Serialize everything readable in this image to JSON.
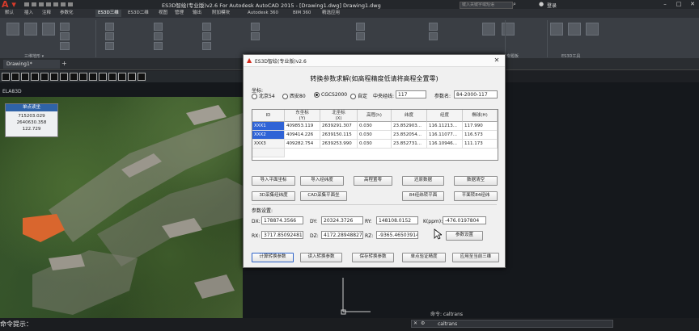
{
  "app": {
    "window_title": "ES3D智绘(专业版)v2.6 For Autodesk AutoCAD 2015 - [Drawing1.dwg]     Drawing1.dwg",
    "search_placeholder": "键入关键字或短语",
    "login": "登录"
  },
  "ribbon_tabs": [
    "默认",
    "插入",
    "注释",
    "参数化",
    "ES3D三维",
    "ES3D二维",
    "视图",
    "管理",
    "输出",
    "附加模块",
    "Autodesk 360",
    "BIM 360",
    "精选应用"
  ],
  "ribbon_active_tab": "ES3D三维",
  "ribbon_groups": [
    "三维地形 ▾",
    "专题板",
    "ES3D工具"
  ],
  "doc_tab": "Drawing1*",
  "viewport_label": "ELA83D",
  "coord_panel": {
    "title": "单点读坐",
    "values": [
      "715203.029",
      "2640630.358",
      "122.729"
    ]
  },
  "command": {
    "prompt": "命令提示：",
    "history": "命令: caltrans",
    "input": "caltrans"
  },
  "dialog": {
    "title": "ES3D智绘(专业版)v2.6",
    "heading": "转换参数求解(如高程精度低请将高程全置零)",
    "coord_label": "坐标:",
    "systems": [
      {
        "label": "北京54",
        "selected": false
      },
      {
        "label": "西安80",
        "selected": false
      },
      {
        "label": "CGCS2000",
        "selected": true
      },
      {
        "label": "自定",
        "selected": false
      }
    ],
    "central_meridian_label": "中央经线:",
    "central_meridian": "117",
    "param_name_label": "参数名:",
    "param_name": "84-2000-117",
    "table": {
      "columns": [
        "ID",
        "东坐标\n(Y)",
        "北坐标\n(X)",
        "高程(h)",
        "纬度",
        "经度",
        "椭球(H)"
      ],
      "rows": [
        [
          "XXX1",
          "409853.119",
          "2639291.307",
          "0.030",
          "23.852903...",
          "116.11213...",
          "117.990"
        ],
        [
          "XXX2",
          "409414.226",
          "2639150.115",
          "0.030",
          "23.852054...",
          "116.11077...",
          "116.573"
        ],
        [
          "XXX3",
          "409282.754",
          "2639253.990",
          "0.030",
          "23.852731...",
          "116.10946...",
          "111.173"
        ]
      ]
    },
    "buttons_row1": [
      "导入平面坐标",
      "导入经纬度",
      "高程置零",
      "还原数据",
      "数据清空"
    ],
    "buttons_row2": [
      "3D采集经纬度",
      "CAD采集平面坐",
      "84经纬转平面",
      "平面转84经纬"
    ],
    "params_label": "参数设置:",
    "params": [
      {
        "label": "DX:",
        "value": "178874.3566"
      },
      {
        "label": "DY:",
        "value": "20324.3726"
      },
      {
        "label": "RY:",
        "value": "148108.0152"
      },
      {
        "label": "K(ppm):",
        "value": "-476.0197804"
      },
      {
        "label": "RX:",
        "value": "3717.85092481"
      },
      {
        "label": "DZ:",
        "value": "4172.28948827"
      },
      {
        "label": "RZ:",
        "value": "-9365.46503914"
      }
    ],
    "param_set_button": "参数设置",
    "bottom_buttons": [
      "计算转换参数",
      "读入转换参数",
      "保存转换参数",
      "单点验证精度",
      "应用至当前三维"
    ]
  }
}
